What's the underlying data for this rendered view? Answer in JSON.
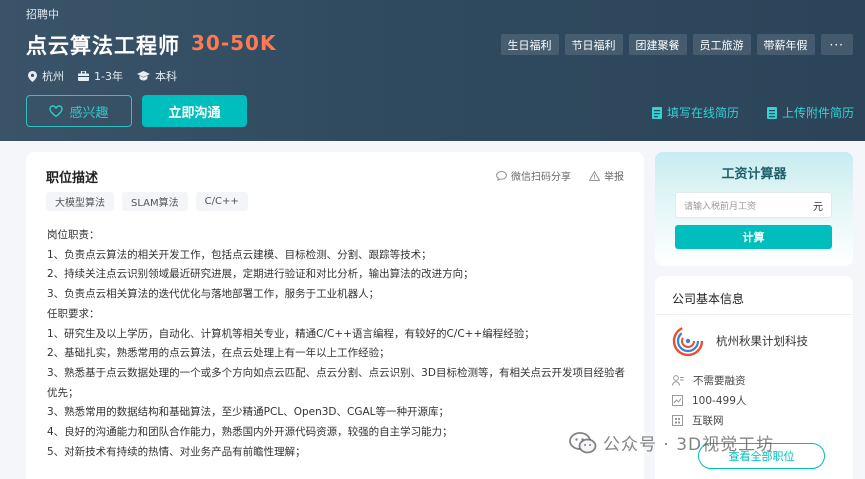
{
  "job": {
    "status": "招聘中",
    "title": "点云算法工程师",
    "salary": "30-50K",
    "location": "杭州",
    "experience": "1-3年",
    "degree": "本科",
    "benefits": [
      "生日福利",
      "节日福利",
      "团建聚餐",
      "员工旅游",
      "带薪年假"
    ],
    "benefits_more": "···",
    "interest_button": "感兴趣",
    "chat_button": "立即沟通",
    "online_resume": "填写在线简历",
    "upload_resume": "上传附件简历"
  },
  "description": {
    "title": "职位描述",
    "share": "微信扫码分享",
    "report": "举报",
    "tags": [
      "大模型算法",
      "SLAM算法",
      "C/C++"
    ],
    "lines": [
      "岗位职责：",
      "1、负责点云算法的相关开发工作，包括点云建模、目标检测、分割、跟踪等技术；",
      "2、持续关注点云识别领域最近研究进展，定期进行验证和对比分析，输出算法的改进方向；",
      "3、负责点云相关算法的迭代优化与落地部署工作，服务于工业机器人；",
      "任职要求：",
      "1、研究生及以上学历，自动化、计算机等相关专业，精通C/C++语言编程，有较好的C/C++编程经验；",
      "2、基础扎实，熟悉常用的点云算法，在点云处理上有一年以上工作经验；",
      "3、熟悉基于点云数据处理的一个或多个方向如点云匹配、点云分割、点云识别、3D目标检测等，有相关点云开发项目经验者优先；",
      "3、熟悉常用的数据结构和基础算法，至少精通PCL、Open3D、CGAL等一种开源库；",
      "4、良好的沟通能力和团队合作能力，熟悉国内外开源代码资源，较强的自主学习能力；",
      "5、对新技术有持续的热情、对业务产品有前瞻性理解；"
    ]
  },
  "calculator": {
    "title": "工资计算器",
    "placeholder": "请输入税前月工资",
    "unit": "元",
    "button": "计算"
  },
  "company": {
    "section_title": "公司基本信息",
    "name": "杭州秋果计划科技",
    "financing": "不需要融资",
    "size": "100-499人",
    "industry": "互联网",
    "view_all": "查看全部职位"
  },
  "watermark": {
    "text": "公众号 · 3D视觉工坊"
  },
  "colors": {
    "accent": "#00bebd",
    "salary": "#ff7a52",
    "header_bg": "#2f4a5f"
  }
}
